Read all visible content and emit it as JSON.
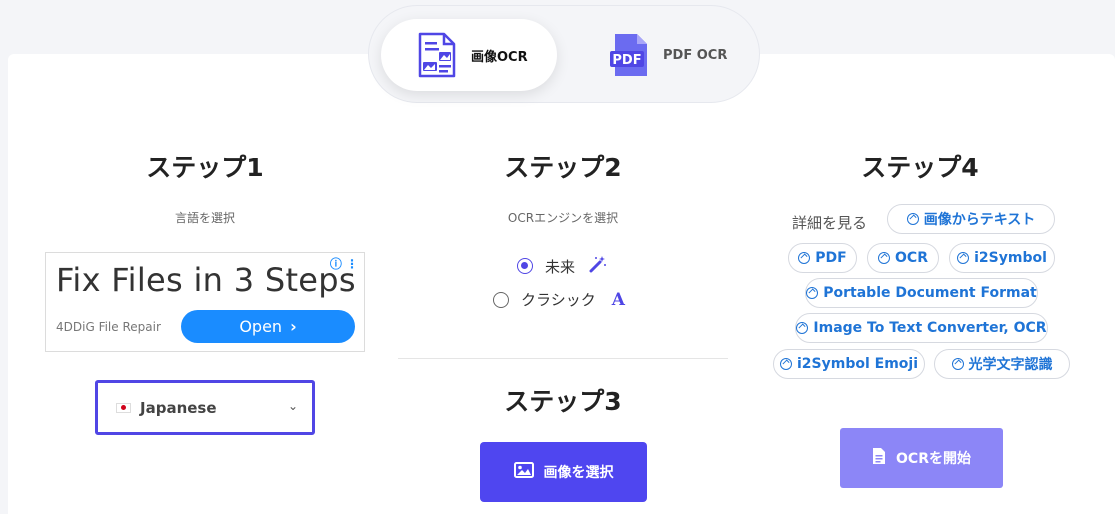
{
  "tabs": [
    {
      "label": "画像OCR",
      "icon": "image-document-icon",
      "active": true
    },
    {
      "label": "PDF OCR",
      "icon": "pdf-icon",
      "active": false
    }
  ],
  "steps": {
    "step1": {
      "title": "ステップ1",
      "subtitle": "言語を選択",
      "language": {
        "value": "Japanese",
        "flag": "japan-flag-icon"
      }
    },
    "step2": {
      "title": "ステップ2",
      "subtitle": "OCRエンジンを選択",
      "options": [
        {
          "label": "未来",
          "selected": true,
          "icon": "magic-wand-icon"
        },
        {
          "label": "クラシック",
          "selected": false,
          "icon": "font-a-icon"
        }
      ]
    },
    "step3": {
      "title": "ステップ3",
      "button": "画像を選択"
    },
    "step4": {
      "title": "ステップ4",
      "details_label": "詳細を見る",
      "chips": [
        "画像からテキスト",
        "PDF",
        "OCR",
        "i2Symbol",
        "Portable Document Format",
        "Image To Text Converter, OCR",
        "i2Symbol Emoji",
        "光学文字認識"
      ],
      "start_button": "OCRを開始"
    }
  },
  "ad": {
    "headline": "Fix Files in 3 Steps",
    "brand": "4DDiG File Repair",
    "button": "Open",
    "info": "ⓘ ⋮"
  },
  "colors": {
    "accent": "#4f46f0",
    "accent_light": "#8c86f7",
    "link": "#1f74d6",
    "ad_button": "#1a8cff"
  }
}
